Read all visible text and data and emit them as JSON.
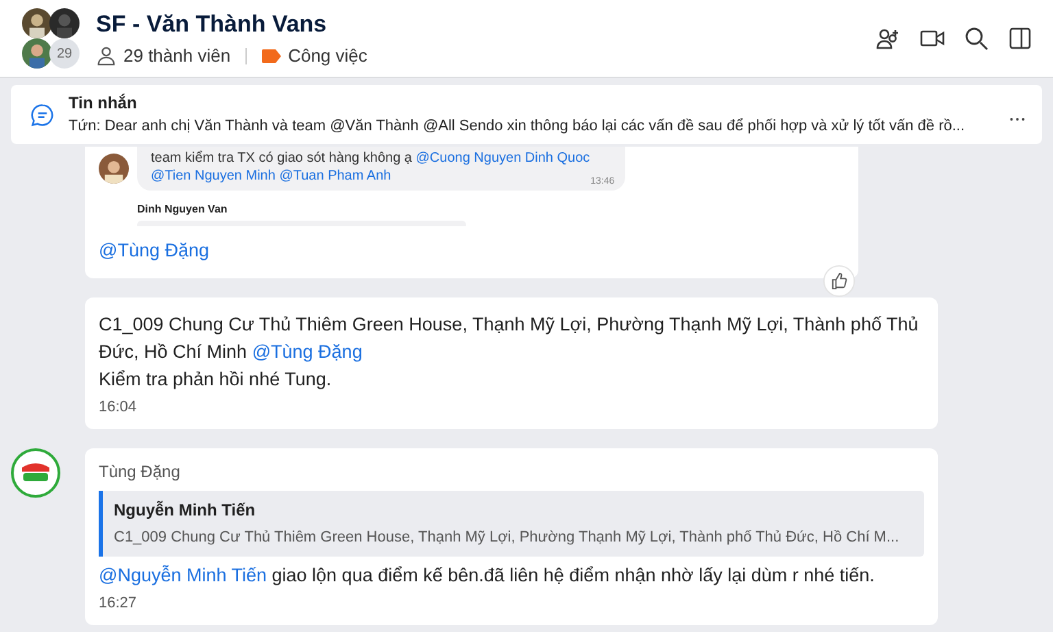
{
  "header": {
    "title": "SF - Văn Thành Vans",
    "avatar_count": "29",
    "members": "29 thành viên",
    "tag": "Công việc"
  },
  "pinned": {
    "label": "Tin nhắn",
    "text": "Tứn: Dear anh chị Văn Thành và team @Văn Thành @All  Sendo xin thông báo lại các vấn đề sau  để phối hợp và xử lý tốt vấn đề rồ..."
  },
  "messages": [
    {
      "kind": "screenshot",
      "quote_lines": [
        [
          {
            "t": "team kiểm tra TX có giao sót hàng không ạ "
          },
          {
            "t": "@Cuong Nguyen Dinh Quoc",
            "mention": true
          }
        ],
        [
          {
            "t": "@Tien Nguyen Minh @Tuan Pham Anh",
            "mention": true
          }
        ]
      ],
      "quote_time": "13:46",
      "next_sender": "Dinh Nguyen Van",
      "body": [
        {
          "t": "@Tùng Đặng",
          "mention": true
        }
      ]
    },
    {
      "kind": "text",
      "body": [
        {
          "t": "C1_009 Chung Cư Thủ Thiêm Green House, Thạnh Mỹ Lợi, Phường Thạnh Mỹ Lợi, Thành phố Thủ Đức, Hồ Chí Minh "
        },
        {
          "t": "@Tùng Đặng",
          "mention": true
        },
        {
          "t": "\nKiểm tra phản hồi nhé Tung."
        }
      ],
      "time": "16:04"
    },
    {
      "kind": "reply",
      "sender": "Tùng Đặng",
      "reply_name": "Nguyễn Minh Tiến",
      "reply_text": "C1_009 Chung Cư Thủ Thiêm Green House, Thạnh Mỹ Lợi, Phường Thạnh Mỹ Lợi, Thành phố Thủ Đức, Hồ Chí M...",
      "body": [
        {
          "t": "@Nguyễn Minh Tiến",
          "mention": true
        },
        {
          "t": " giao lộn qua điểm kế bên.đã liên hệ điểm nhận nhờ lấy lại dùm r nhé tiến."
        }
      ],
      "time": "16:27"
    }
  ]
}
